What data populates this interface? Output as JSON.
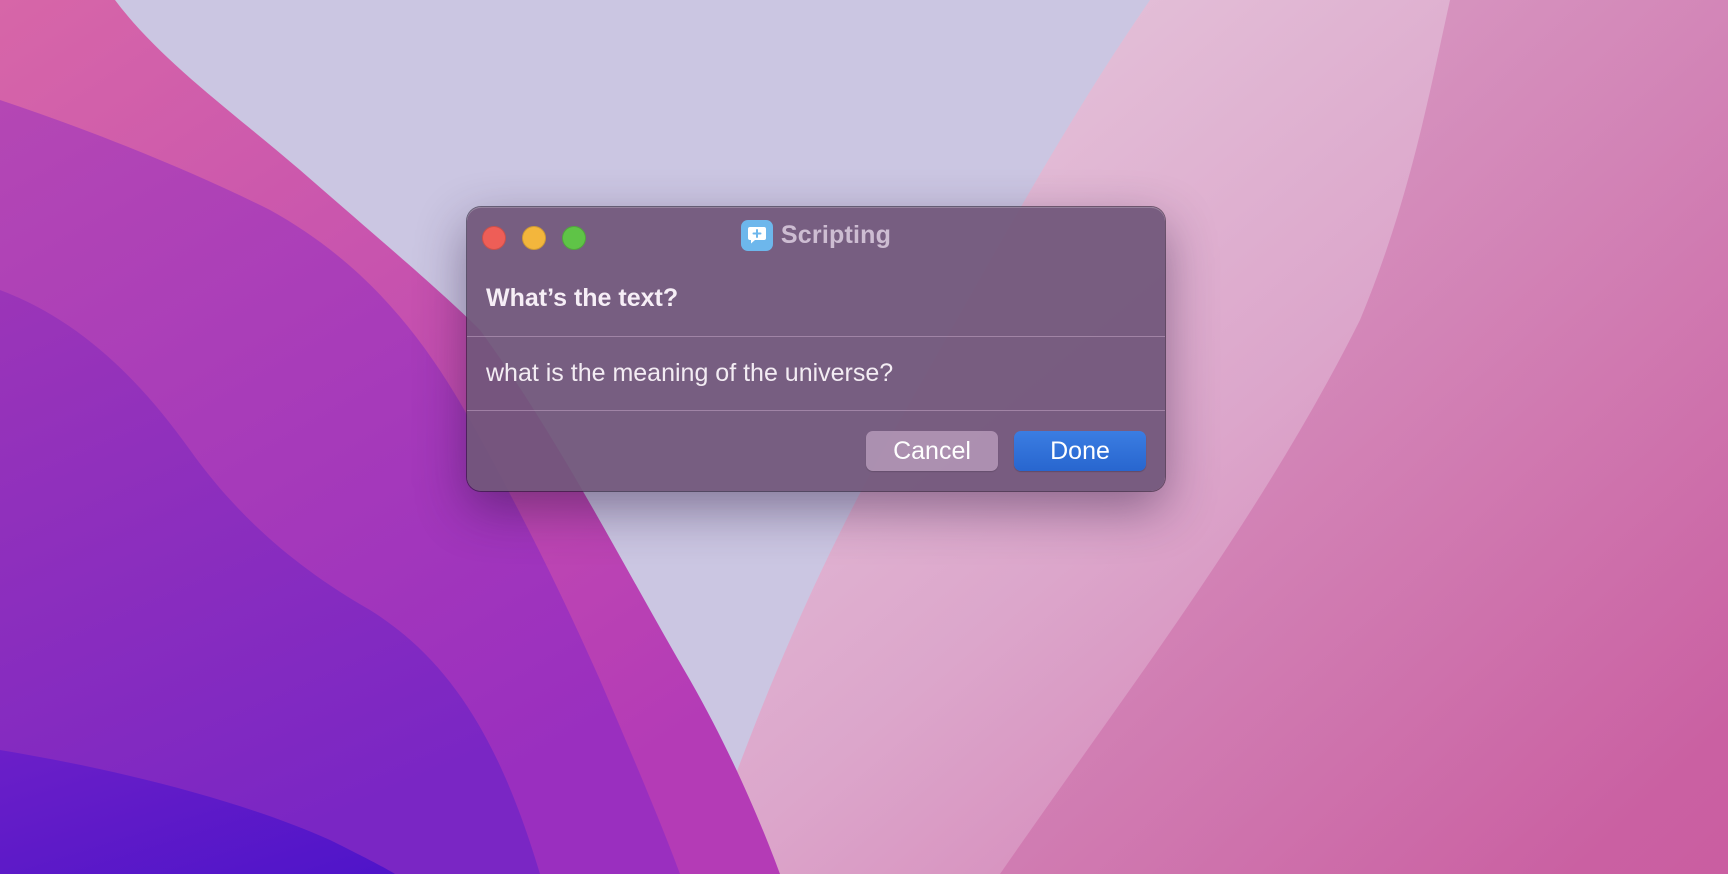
{
  "window": {
    "title": "Scripting",
    "app_icon": "chat-bubble-plus-icon"
  },
  "dialog": {
    "prompt": "What’s the text?",
    "input_value": "what is the meaning of the universe?",
    "input_placeholder": "",
    "cancel_label": "Cancel",
    "done_label": "Done"
  },
  "colors": {
    "close": "#ee5e57",
    "minimize": "#f3b63c",
    "zoom": "#5fc447",
    "accent": "#2f6fd8",
    "app_icon": "#6db7ec"
  }
}
